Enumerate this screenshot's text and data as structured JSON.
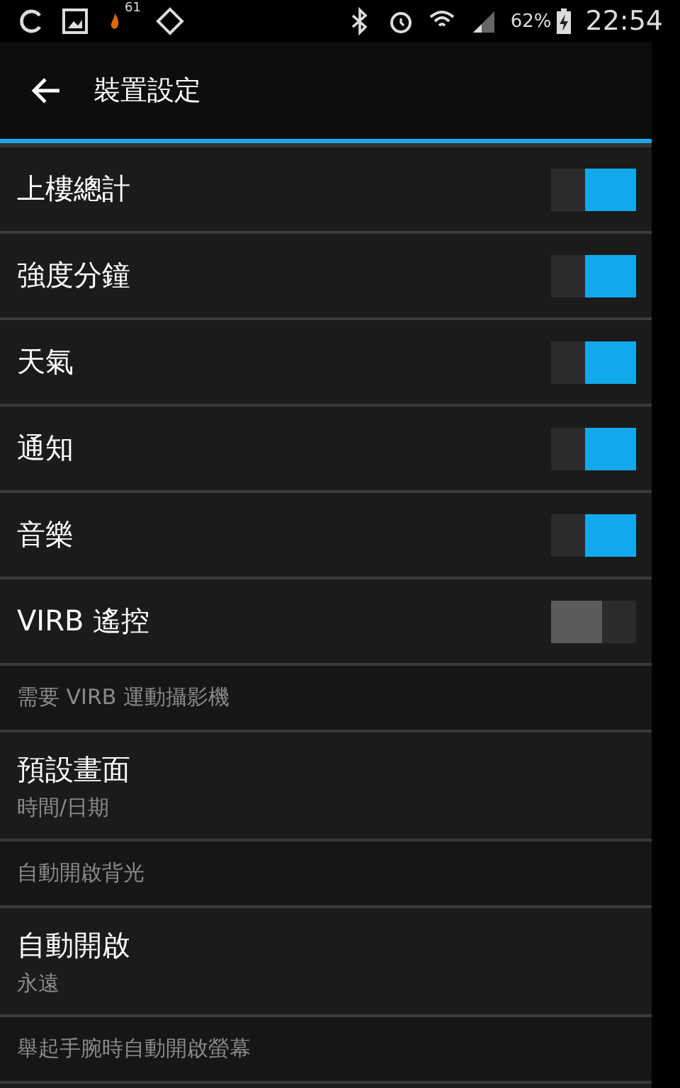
{
  "status_bar": {
    "notification_badge": "61",
    "battery_percent": "62%",
    "time": "22:54"
  },
  "app_bar": {
    "title": "裝置設定"
  },
  "items": [
    {
      "kind": "toggle",
      "label": "上樓總計",
      "on": true
    },
    {
      "kind": "toggle",
      "label": "強度分鐘",
      "on": true
    },
    {
      "kind": "toggle",
      "label": "天氣",
      "on": true
    },
    {
      "kind": "toggle",
      "label": "通知",
      "on": true
    },
    {
      "kind": "toggle",
      "label": "音樂",
      "on": true
    },
    {
      "kind": "toggle",
      "label": "VIRB 遙控",
      "on": false
    },
    {
      "kind": "header",
      "label": "需要 VIRB 運動攝影機"
    },
    {
      "kind": "detail",
      "label": "預設畫面",
      "value": "時間/日期"
    },
    {
      "kind": "header",
      "label": "自動開啟背光"
    },
    {
      "kind": "detail",
      "label": "自動開啟",
      "value": "永遠"
    },
    {
      "kind": "header",
      "label": "舉起手腕時自動開啟螢幕"
    }
  ]
}
